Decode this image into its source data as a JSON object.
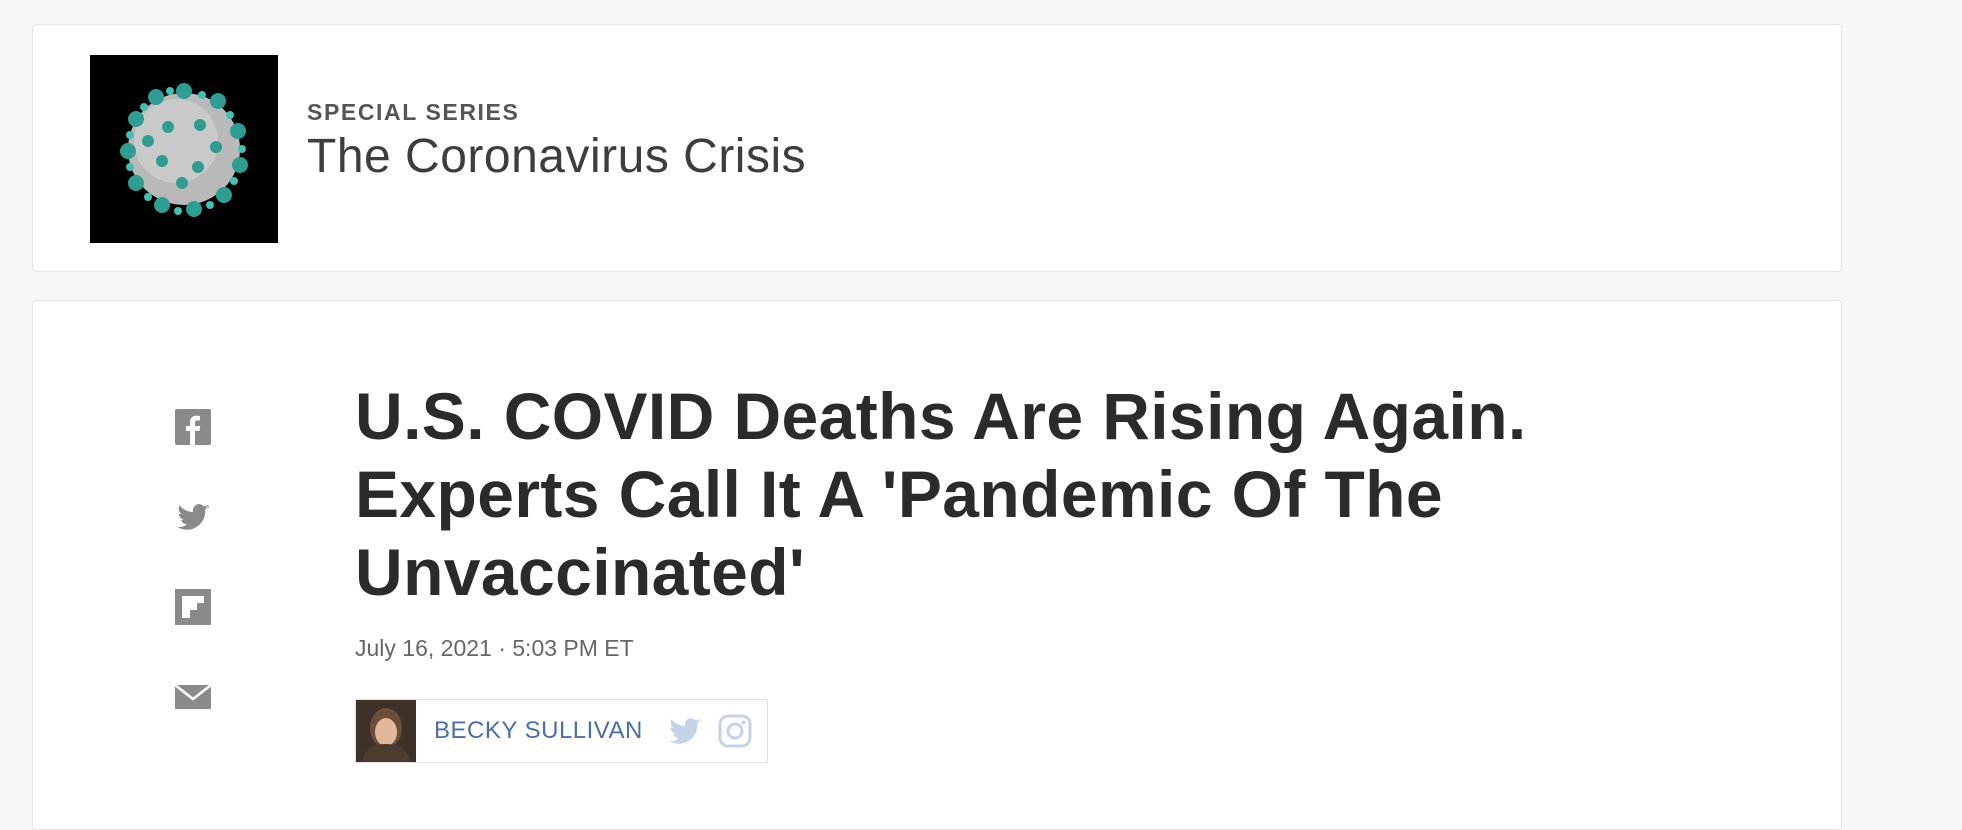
{
  "series": {
    "eyebrow": "SPECIAL SERIES",
    "title": "The Coronavirus Crisis",
    "thumbnail_icon": "coronavirus-illustration"
  },
  "share": {
    "items": [
      {
        "icon": "facebook-icon"
      },
      {
        "icon": "twitter-icon"
      },
      {
        "icon": "flipboard-icon"
      },
      {
        "icon": "email-icon"
      }
    ],
    "icon_color": "#8a8a8a"
  },
  "article": {
    "headline": "U.S. COVID Deaths Are Rising Again. Experts Call It A 'Pandemic Of The Unvaccinated'",
    "date": "July 16, 2021 · 5:03 PM ET",
    "byline": {
      "name": "BECKY SULLIVAN",
      "social_icons": [
        "twitter-icon",
        "instagram-icon"
      ],
      "name_color": "#4a6fa5",
      "social_color": "#c5d3e8"
    }
  }
}
